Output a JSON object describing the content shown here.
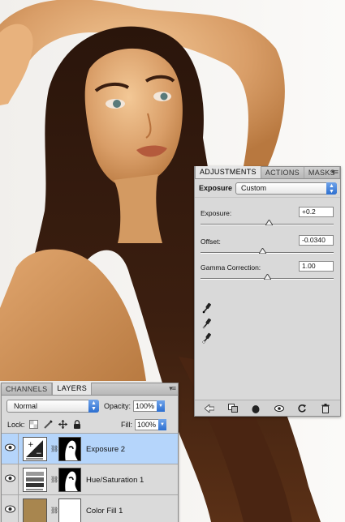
{
  "adjustments_panel": {
    "tabs": [
      "ADJUSTMENTS",
      "ACTIONS",
      "MASKS"
    ],
    "active_tab": "ADJUSTMENTS",
    "menu_icon": "panel-menu-icon",
    "header_label": "Exposure",
    "preset_value": "Custom",
    "sliders": [
      {
        "label": "Exposure:",
        "value": "+0.2",
        "position": 0.51
      },
      {
        "label": "Offset:",
        "value": "-0.0340",
        "position": 0.46
      },
      {
        "label": "Gamma Correction:",
        "value": "1.00",
        "position": 0.5
      }
    ],
    "eyedroppers": [
      "black-point-eyedropper-icon",
      "gray-point-eyedropper-icon",
      "white-point-eyedropper-icon"
    ],
    "footer_icons": [
      "back-arrow-icon",
      "clip-to-layer-icon",
      "toggle-visibility-icon",
      "view-previous-icon",
      "reset-icon",
      "delete-icon"
    ]
  },
  "layers_panel": {
    "tabs": [
      "CHANNELS",
      "LAYERS"
    ],
    "active_tab": "LAYERS",
    "blend_mode": "Normal",
    "opacity_label": "Opacity:",
    "opacity_value": "100%",
    "lock_label": "Lock:",
    "fill_label": "Fill:",
    "fill_value": "100%",
    "layers": [
      {
        "name": "Exposure 2",
        "selected": true,
        "thumb_type": "exposure-adjustment-icon"
      },
      {
        "name": "Hue/Saturation 1",
        "selected": false,
        "thumb_type": "hue-saturation-adjustment-icon"
      },
      {
        "name": "Color Fill 1",
        "selected": false,
        "thumb_type": "color-fill-swatch",
        "swatch_color": "#a8864f"
      }
    ]
  },
  "colors": {
    "panel_bg": "#dcdcdc",
    "selected_layer": "#b5d5fb",
    "accent_blue": "#2d6fd0",
    "fill_swatch": "#a8864f"
  }
}
